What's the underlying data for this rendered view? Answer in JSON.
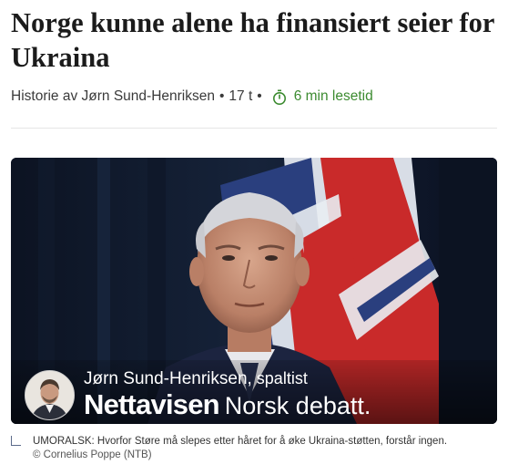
{
  "article": {
    "headline": "Norge kunne alene ha finansiert seier for Ukraina",
    "byline_prefix": "Historie av Jørn Sund-Henriksen",
    "separator": "•",
    "age": "17 t",
    "read_time": "6 min lesetid",
    "read_time_color": "#3c8b30"
  },
  "hero": {
    "author_name": "Jørn Sund-Henriksen,",
    "author_role": " spaltist",
    "brand": "Nettavisen",
    "section": "Norsk debatt."
  },
  "caption": {
    "text": "UMORALSK: Hvorfor Støre må slepes etter håret for å øke Ukraina-støtten, forstår ingen.",
    "credit": "© Cornelius Poppe (NTB)"
  },
  "icons": [
    "timer-icon"
  ]
}
